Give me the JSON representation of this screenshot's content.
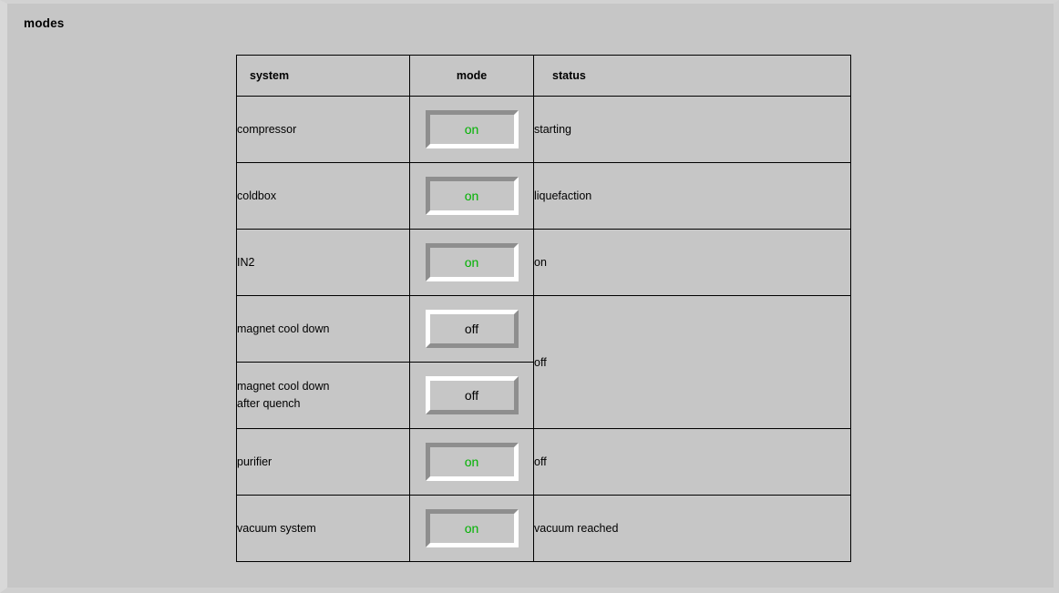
{
  "window": {
    "title": "modes"
  },
  "table": {
    "columns": [
      {
        "key": "system",
        "label": "system"
      },
      {
        "key": "mode",
        "label": "mode"
      },
      {
        "key": "status",
        "label": "status"
      }
    ],
    "rows": [
      {
        "system": "compressor",
        "system_line2": "",
        "mode": "on",
        "mode_state": "on",
        "status": "starting"
      },
      {
        "system": "coldbox",
        "system_line2": "",
        "mode": "on",
        "mode_state": "on",
        "status": "liquefaction"
      },
      {
        "system": "IN2",
        "system_line2": "",
        "mode": "on",
        "mode_state": "on",
        "status": "on"
      },
      {
        "system": "magnet cool down",
        "system_line2": "",
        "mode": "off",
        "mode_state": "off",
        "status": "off",
        "status_rowspan": 2
      },
      {
        "system": "magnet cool down",
        "system_line2": "after quench",
        "mode": "off",
        "mode_state": "off",
        "status": null
      },
      {
        "system": "purifier",
        "system_line2": "",
        "mode": "on",
        "mode_state": "on",
        "status": "off"
      },
      {
        "system": "vacuum system",
        "system_line2": "",
        "mode": "on",
        "mode_state": "on",
        "status": "vacuum reached"
      }
    ]
  },
  "colors": {
    "background": "#c6c6c6",
    "on_text": "#00b200",
    "off_text": "#000000",
    "border": "#000000",
    "bevel_light": "#ffffff",
    "bevel_dark": "#8e8e8e"
  }
}
